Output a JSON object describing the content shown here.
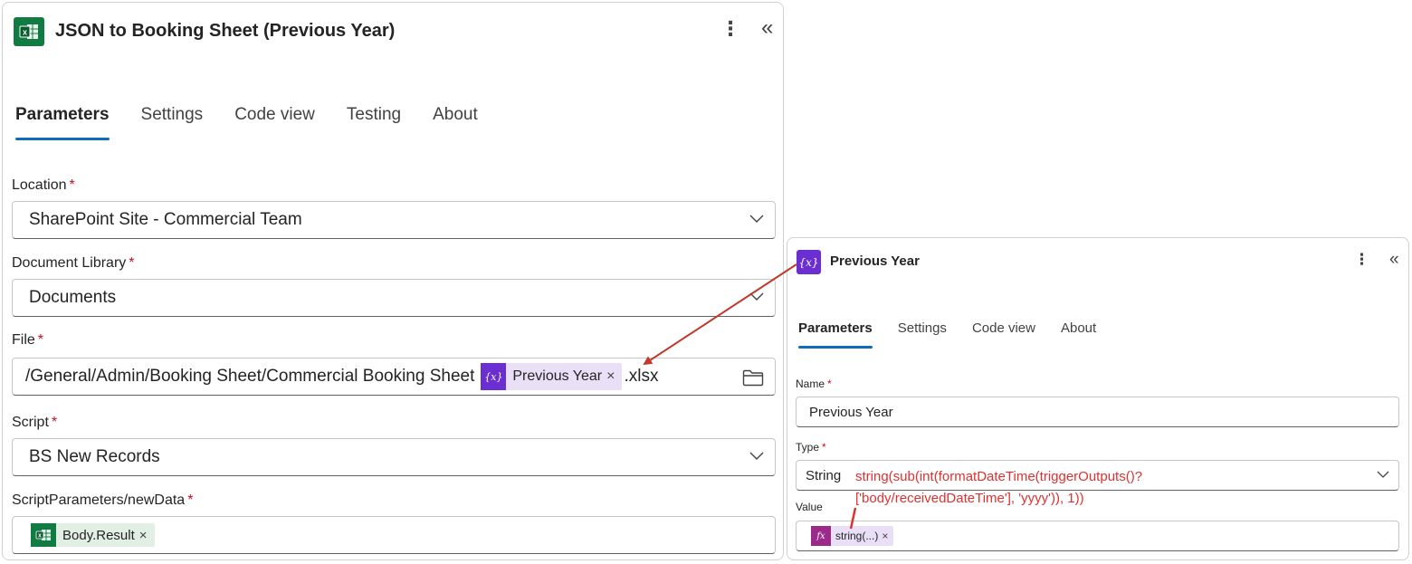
{
  "left_panel": {
    "title": "JSON to Booking Sheet (Previous Year)",
    "icon": "excel-icon",
    "icon_color": "#107c41",
    "tabs": [
      {
        "label": "Parameters",
        "active": true
      },
      {
        "label": "Settings",
        "active": false
      },
      {
        "label": "Code view",
        "active": false
      },
      {
        "label": "Testing",
        "active": false
      },
      {
        "label": "About",
        "active": false
      }
    ],
    "fields": {
      "location": {
        "label": "Location",
        "required": "*",
        "value": "SharePoint Site - Commercial Team"
      },
      "document_library": {
        "label": "Document Library",
        "required": "*",
        "value": "Documents"
      },
      "file": {
        "label": "File",
        "required": "*",
        "prefix": "/General/Admin/Booking Sheet/Commercial Booking Sheet",
        "token_label": "Previous Year",
        "token_remove": "×",
        "suffix": ".xlsx"
      },
      "script": {
        "label": "Script",
        "required": "*",
        "value": "BS New Records"
      },
      "script_parameters": {
        "label": "ScriptParameters/newData",
        "required": "*",
        "token_label": "Body.Result",
        "token_remove": "×"
      }
    }
  },
  "right_panel": {
    "title": "Previous Year",
    "icon": "variable-icon",
    "icon_glyph": "{x}",
    "icon_color": "#6b2fd1",
    "tabs": [
      {
        "label": "Parameters",
        "active": true
      },
      {
        "label": "Settings",
        "active": false
      },
      {
        "label": "Code view",
        "active": false
      },
      {
        "label": "About",
        "active": false
      }
    ],
    "fields": {
      "name": {
        "label": "Name",
        "required": "*",
        "value": "Previous Year"
      },
      "type": {
        "label": "Type",
        "required": "*",
        "value": "String"
      },
      "value": {
        "label": "Value",
        "token_glyph": "fx",
        "token_label": "string(...)",
        "token_remove": "×"
      }
    }
  },
  "annotation": {
    "line1": "string(sub(int(formatDateTime(triggerOutputs()?",
    "line2": "['body/receivedDateTime'], 'yyyy')), 1))",
    "color": "#e03030"
  },
  "colors": {
    "accent": "#0f6cbd",
    "required": "#c50f1f",
    "token_background": "#e9dff7",
    "arrow": "#c0392b"
  }
}
